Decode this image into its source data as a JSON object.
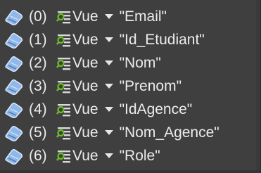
{
  "items": [
    {
      "index": "(0)",
      "type": "Vue",
      "value": "\"Email\"",
      "icon": "node-icon",
      "type_icon": "view-icon",
      "dropdown_icon": "caret-down-icon"
    },
    {
      "index": "(1)",
      "type": "Vue",
      "value": "\"Id_Etudiant\"",
      "icon": "node-icon",
      "type_icon": "view-icon",
      "dropdown_icon": "caret-down-icon"
    },
    {
      "index": "(2)",
      "type": "Vue",
      "value": "\"Nom\"",
      "icon": "node-icon",
      "type_icon": "view-icon",
      "dropdown_icon": "caret-down-icon"
    },
    {
      "index": "(3)",
      "type": "Vue",
      "value": "\"Prenom\"",
      "icon": "node-icon",
      "type_icon": "view-icon",
      "dropdown_icon": "caret-down-icon"
    },
    {
      "index": "(4)",
      "type": "Vue",
      "value": "\"IdAgence\"",
      "icon": "node-icon",
      "type_icon": "view-icon",
      "dropdown_icon": "caret-down-icon"
    },
    {
      "index": "(5)",
      "type": "Vue",
      "value": "\"Nom_Agence\"",
      "icon": "node-icon",
      "type_icon": "view-icon",
      "dropdown_icon": "caret-down-icon"
    },
    {
      "index": "(6)",
      "type": "Vue",
      "value": "\"Role\"",
      "icon": "node-icon",
      "type_icon": "view-icon",
      "dropdown_icon": "caret-down-icon"
    }
  ],
  "colors": {
    "background": "#3f3f3f",
    "text": "#ececec",
    "node_icon": "#8fb8ea",
    "view_icon_lens": "#6bbf2b",
    "view_icon_lines": "#d8d8d8"
  }
}
